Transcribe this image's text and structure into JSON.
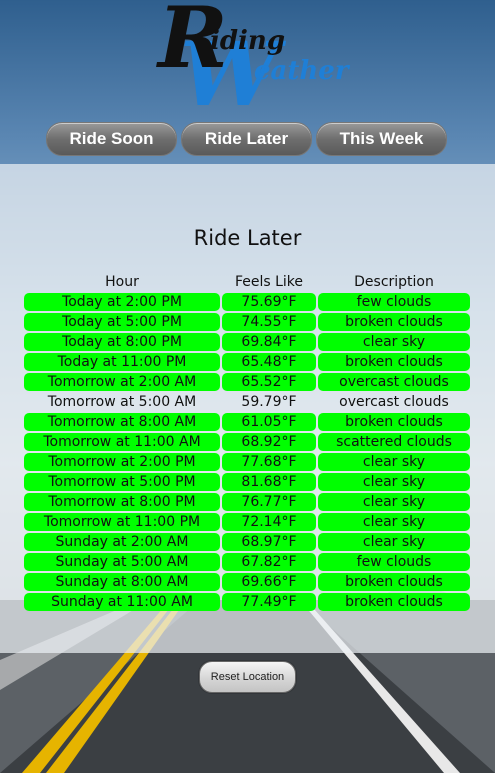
{
  "logo": {
    "big_r": "R",
    "small_1": "iding",
    "big_w": "W",
    "small_2": "eather"
  },
  "nav": {
    "buttons": [
      "Ride Soon",
      "Ride Later",
      "This Week"
    ]
  },
  "main": {
    "title": "Ride Later",
    "headers": [
      "Hour",
      "Feels Like",
      "Description"
    ],
    "rows": [
      {
        "hour": "Today at 2:00 PM",
        "feels": "75.69°F",
        "desc": "few clouds",
        "highlight": true
      },
      {
        "hour": "Today at 5:00 PM",
        "feels": "74.55°F",
        "desc": "broken clouds",
        "highlight": true
      },
      {
        "hour": "Today at 8:00 PM",
        "feels": "69.84°F",
        "desc": "clear sky",
        "highlight": true
      },
      {
        "hour": "Today at 11:00 PM",
        "feels": "65.48°F",
        "desc": "broken clouds",
        "highlight": true
      },
      {
        "hour": "Tomorrow at 2:00 AM",
        "feels": "65.52°F",
        "desc": "overcast clouds",
        "highlight": true
      },
      {
        "hour": "Tomorrow at 5:00 AM",
        "feels": "59.79°F",
        "desc": "overcast clouds",
        "highlight": false
      },
      {
        "hour": "Tomorrow at 8:00 AM",
        "feels": "61.05°F",
        "desc": "broken clouds",
        "highlight": true
      },
      {
        "hour": "Tomorrow at 11:00 AM",
        "feels": "68.92°F",
        "desc": "scattered clouds",
        "highlight": true
      },
      {
        "hour": "Tomorrow at 2:00 PM",
        "feels": "77.68°F",
        "desc": "clear sky",
        "highlight": true
      },
      {
        "hour": "Tomorrow at 5:00 PM",
        "feels": "81.68°F",
        "desc": "clear sky",
        "highlight": true
      },
      {
        "hour": "Tomorrow at 8:00 PM",
        "feels": "76.77°F",
        "desc": "clear sky",
        "highlight": true
      },
      {
        "hour": "Tomorrow at 11:00 PM",
        "feels": "72.14°F",
        "desc": "clear sky",
        "highlight": true
      },
      {
        "hour": "Sunday at 2:00 AM",
        "feels": "68.97°F",
        "desc": "clear sky",
        "highlight": true
      },
      {
        "hour": "Sunday at 5:00 AM",
        "feels": "67.82°F",
        "desc": "few clouds",
        "highlight": true
      },
      {
        "hour": "Sunday at 8:00 AM",
        "feels": "69.66°F",
        "desc": "broken clouds",
        "highlight": true
      },
      {
        "hour": "Sunday at 11:00 AM",
        "feels": "77.49°F",
        "desc": "broken clouds",
        "highlight": true
      }
    ]
  },
  "footer": {
    "reset_label": "Reset Location"
  },
  "colors": {
    "highlight": "#00ff00",
    "logo_blue": "#1f7fd6",
    "logo_black": "#111111"
  }
}
